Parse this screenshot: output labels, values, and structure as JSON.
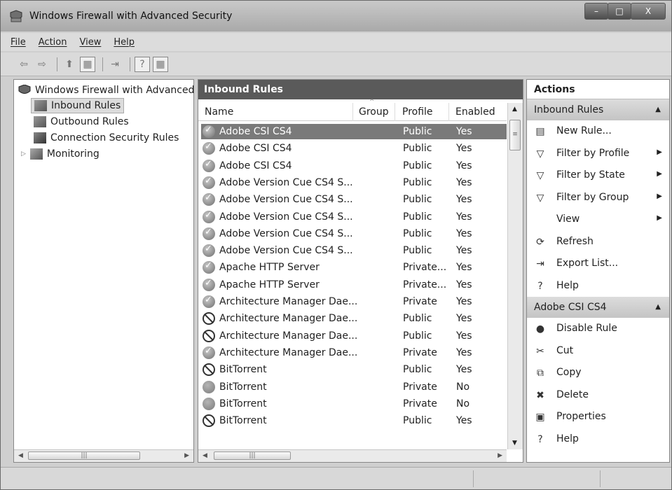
{
  "window": {
    "title": "Windows Firewall with Advanced Security",
    "min": "–",
    "max": "□",
    "close": "X"
  },
  "menu": [
    "File",
    "Action",
    "View",
    "Help"
  ],
  "toolbar": {
    "back": "⇦",
    "forward": "⇨",
    "up": "⬆",
    "show_hide_tree": "▦",
    "export": "⇥",
    "help": "?",
    "show_hide_action": "▦"
  },
  "tree": {
    "root": "Windows Firewall with Advanced",
    "items": [
      "Inbound Rules",
      "Outbound Rules",
      "Connection Security Rules",
      "Monitoring"
    ],
    "selected": "Inbound Rules",
    "scroll_thumb": "|||"
  },
  "list": {
    "header": "Inbound Rules",
    "columns": [
      "Name",
      "Group",
      "Profile",
      "Enabled"
    ],
    "rows": [
      {
        "status": "allow",
        "name": "Adobe CSI CS4",
        "profile": "Public",
        "enabled": "Yes",
        "selected": true
      },
      {
        "status": "allow",
        "name": "Adobe CSI CS4",
        "profile": "Public",
        "enabled": "Yes"
      },
      {
        "status": "allow",
        "name": "Adobe CSI CS4",
        "profile": "Public",
        "enabled": "Yes"
      },
      {
        "status": "allow",
        "name": "Adobe Version Cue CS4 S...",
        "profile": "Public",
        "enabled": "Yes"
      },
      {
        "status": "allow",
        "name": "Adobe Version Cue CS4 S...",
        "profile": "Public",
        "enabled": "Yes"
      },
      {
        "status": "allow",
        "name": "Adobe Version Cue CS4 S...",
        "profile": "Public",
        "enabled": "Yes"
      },
      {
        "status": "allow",
        "name": "Adobe Version Cue CS4 S...",
        "profile": "Public",
        "enabled": "Yes"
      },
      {
        "status": "allow",
        "name": "Adobe Version Cue CS4 S...",
        "profile": "Public",
        "enabled": "Yes"
      },
      {
        "status": "allow",
        "name": "Apache HTTP Server",
        "profile": "Private...",
        "enabled": "Yes"
      },
      {
        "status": "allow",
        "name": "Apache HTTP Server",
        "profile": "Private...",
        "enabled": "Yes"
      },
      {
        "status": "allow",
        "name": "Architecture Manager Dae...",
        "profile": "Private",
        "enabled": "Yes"
      },
      {
        "status": "block",
        "name": "Architecture Manager Dae...",
        "profile": "Public",
        "enabled": "Yes"
      },
      {
        "status": "block",
        "name": "Architecture Manager Dae...",
        "profile": "Public",
        "enabled": "Yes"
      },
      {
        "status": "allow",
        "name": "Architecture Manager Dae...",
        "profile": "Private",
        "enabled": "Yes"
      },
      {
        "status": "block",
        "name": "BitTorrent",
        "profile": "Public",
        "enabled": "Yes"
      },
      {
        "status": "disabled",
        "name": "BitTorrent",
        "profile": "Private",
        "enabled": "No"
      },
      {
        "status": "disabled",
        "name": "BitTorrent",
        "profile": "Private",
        "enabled": "No"
      },
      {
        "status": "block",
        "name": "BitTorrent",
        "profile": "Public",
        "enabled": "Yes"
      }
    ],
    "scroll_thumb": "|||"
  },
  "actions": {
    "title": "Actions",
    "section1": {
      "label": "Inbound Rules",
      "items": [
        {
          "icon": "new-rule-icon",
          "glyph": "▤",
          "label": "New Rule...",
          "submenu": false
        },
        {
          "icon": "filter-icon",
          "glyph": "▽",
          "label": "Filter by Profile",
          "submenu": true
        },
        {
          "icon": "filter-icon",
          "glyph": "▽",
          "label": "Filter by State",
          "submenu": true
        },
        {
          "icon": "filter-icon",
          "glyph": "▽",
          "label": "Filter by Group",
          "submenu": true
        },
        {
          "icon": "",
          "glyph": "",
          "label": "View",
          "submenu": true
        },
        {
          "icon": "refresh-icon",
          "glyph": "⟳",
          "label": "Refresh",
          "submenu": false
        },
        {
          "icon": "export-list-icon",
          "glyph": "⇥",
          "label": "Export List...",
          "submenu": false
        },
        {
          "icon": "help-icon",
          "glyph": "?",
          "label": "Help",
          "submenu": false
        }
      ]
    },
    "section2": {
      "label": "Adobe CSI CS4",
      "items": [
        {
          "icon": "disable-rule-icon",
          "glyph": "●",
          "label": "Disable Rule",
          "submenu": false
        },
        {
          "icon": "cut-icon",
          "glyph": "✂",
          "label": "Cut",
          "submenu": false
        },
        {
          "icon": "copy-icon",
          "glyph": "⧉",
          "label": "Copy",
          "submenu": false
        },
        {
          "icon": "delete-icon",
          "glyph": "✖",
          "label": "Delete",
          "submenu": false
        },
        {
          "icon": "properties-icon",
          "glyph": "▣",
          "label": "Properties",
          "submenu": false
        },
        {
          "icon": "help-icon",
          "glyph": "?",
          "label": "Help",
          "submenu": false
        }
      ]
    }
  }
}
